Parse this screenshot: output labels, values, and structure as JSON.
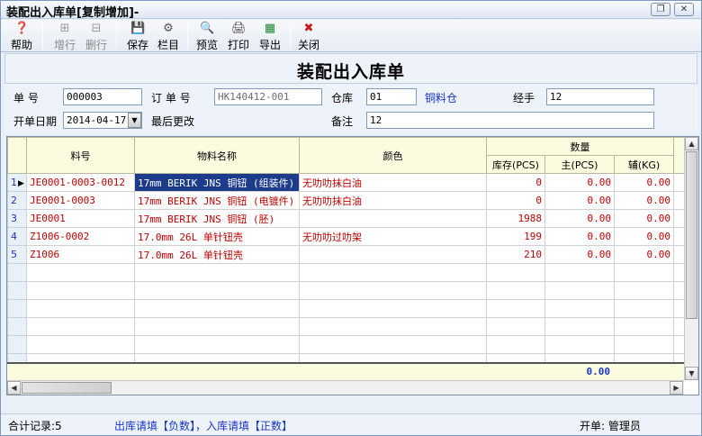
{
  "window": {
    "title": "装配出入库单[复制增加]-",
    "restore_glyph": "❐",
    "close_glyph": "✕"
  },
  "toolbar": {
    "items": [
      {
        "label": "帮助",
        "icon": "help-icon",
        "glyph": "❓",
        "enabled": true
      },
      {
        "label": "增行",
        "icon": "add-row-icon",
        "glyph": "⊞",
        "enabled": false
      },
      {
        "label": "删行",
        "icon": "delete-row-icon",
        "glyph": "⊟",
        "enabled": false
      },
      {
        "label": "保存",
        "icon": "save-icon",
        "glyph": "💾",
        "enabled": true
      },
      {
        "label": "栏目",
        "icon": "columns-icon",
        "glyph": "⚙",
        "enabled": true
      },
      {
        "label": "预览",
        "icon": "preview-icon",
        "glyph": "🔍",
        "enabled": true
      },
      {
        "label": "打印",
        "icon": "print-icon",
        "glyph": "🖨",
        "enabled": true
      },
      {
        "label": "导出",
        "icon": "export-icon",
        "glyph": "▦",
        "enabled": true
      },
      {
        "label": "关闭",
        "icon": "close-icon",
        "glyph": "✖",
        "enabled": true
      }
    ]
  },
  "doc_title": "装配出入库单",
  "form": {
    "no_label": "单    号",
    "no_value": "000003",
    "order_label": "订 单 号",
    "order_value": "HK140412-001",
    "warehouse_label": "仓库",
    "warehouse_value": "01",
    "warehouse_name": "铜料仓",
    "handler_label": "经手",
    "handler_value": "12",
    "date_label": "开单日期",
    "date_value": "2014-04-17",
    "last_modified_label": "最后更改",
    "note_label": "备注",
    "note_value": "12"
  },
  "grid": {
    "headers": {
      "part_no": "料号",
      "name": "物料名称",
      "color": "颜色",
      "qty": "数量",
      "stock": "库存(PCS)",
      "main": "主(PCS)",
      "aux": "辅(KG)"
    },
    "rows": [
      {
        "no": "1",
        "part_no": "JE0001-0003-0012",
        "name": "17mm BERIK JNS 铜钮 (组装件)",
        "color": "无叻叻抹白油",
        "stock": "0",
        "main": "0.00",
        "aux": "0.00"
      },
      {
        "no": "2",
        "part_no": "JE0001-0003",
        "name": "17mm BERIK JNS 铜钮 (电镀件)",
        "color": "无叻叻抹白油",
        "stock": "0",
        "main": "0.00",
        "aux": "0.00"
      },
      {
        "no": "3",
        "part_no": "JE0001",
        "name": "17mm BERIK JNS 铜钮 (胚)",
        "color": "",
        "stock": "1988",
        "main": "0.00",
        "aux": "0.00"
      },
      {
        "no": "4",
        "part_no": "Z1006-0002",
        "name": "17.0mm 26L 单针钮壳",
        "color": "无叻叻过叻架",
        "stock": "199",
        "main": "0.00",
        "aux": "0.00"
      },
      {
        "no": "5",
        "part_no": "Z1006",
        "name": "17.0mm 26L 单针钮壳",
        "color": "",
        "stock": "210",
        "main": "0.00",
        "aux": "0.00"
      }
    ],
    "row_pointer": "▶",
    "total_main": "0.00"
  },
  "status": {
    "records": "合计记录:5",
    "hint": "出库请填【负数】，入库请填【正数】",
    "creator": "开单: 管理员"
  },
  "colors": {
    "red": "#c00000",
    "link_blue": "#1a36c9",
    "selection": "#1c3b8a"
  }
}
